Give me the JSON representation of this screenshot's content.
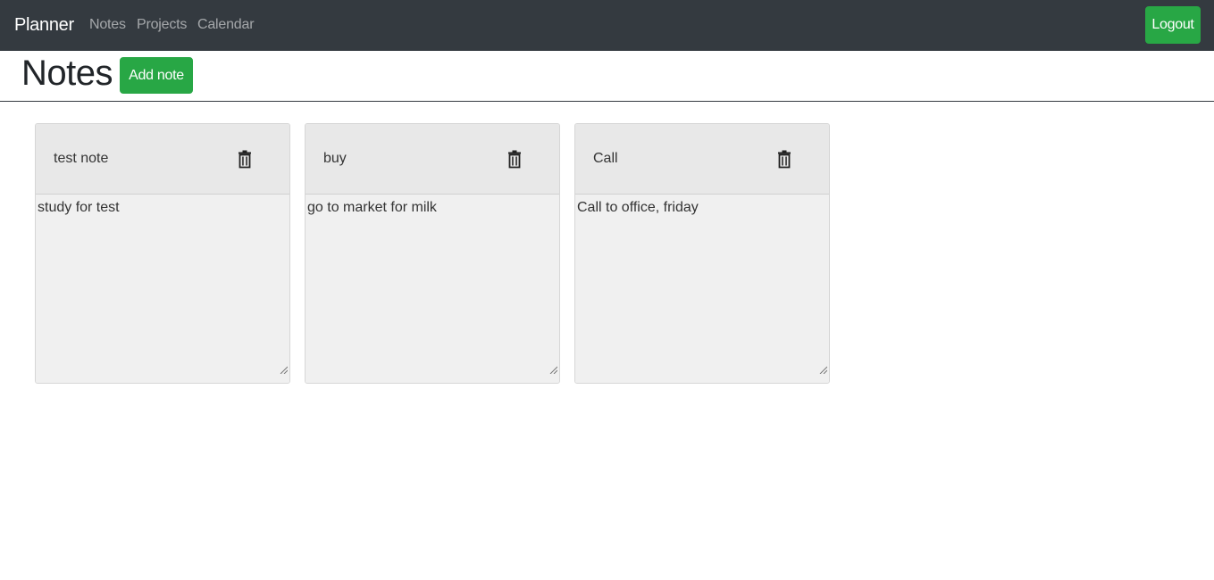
{
  "navbar": {
    "brand": "Planner",
    "links": [
      "Notes",
      "Projects",
      "Calendar"
    ],
    "logout_label": "Logout",
    "background": "#343a40"
  },
  "page": {
    "title": "Notes",
    "add_note_label": "Add note",
    "accent": "#28a745"
  },
  "notes": [
    {
      "title": "test note",
      "body": "study for test",
      "icon": "trash-icon"
    },
    {
      "title": "buy",
      "body": "go to market for milk",
      "icon": "trash-icon"
    },
    {
      "title": "Call",
      "body": "Call to office, friday",
      "icon": "trash-icon"
    }
  ]
}
